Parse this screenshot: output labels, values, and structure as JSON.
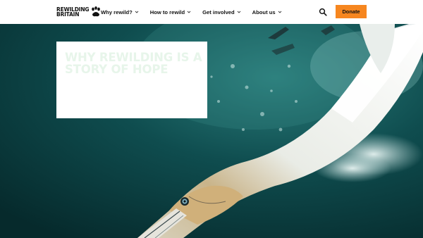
{
  "header": {
    "logo": {
      "line1": "REWILDING",
      "line2": "BRITAIN",
      "icon": "paw-icon"
    },
    "nav": [
      {
        "label": "Why rewild?"
      },
      {
        "label": "How to rewild"
      },
      {
        "label": "Get involved"
      },
      {
        "label": "About us"
      }
    ],
    "search_icon": "search-icon",
    "donate_label": "Donate"
  },
  "hero": {
    "title": "WHY REWILDING IS A STORY OF HOPE",
    "image": "gannet-diving-underwater"
  },
  "colors": {
    "accent": "#f6861f",
    "water": "#0b3a3c",
    "title_text": "#e7f5ea"
  }
}
